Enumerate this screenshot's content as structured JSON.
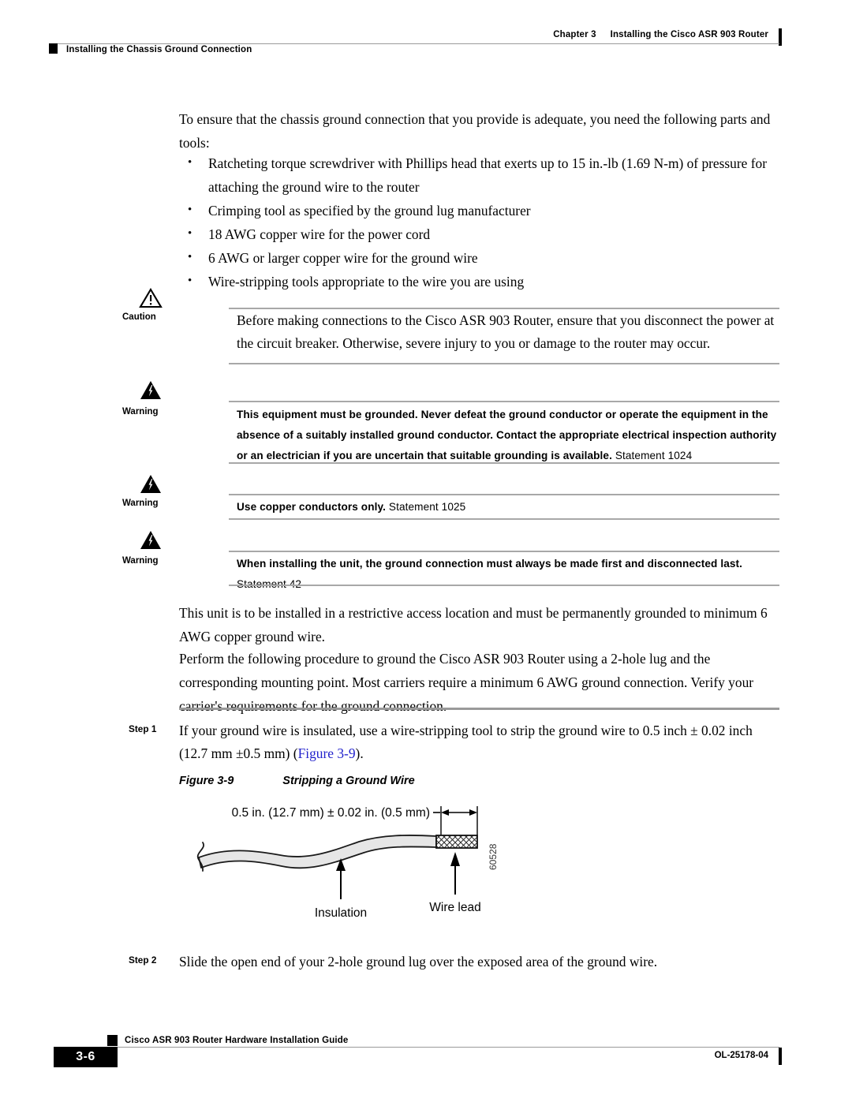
{
  "header": {
    "chapter_num": "Chapter 3",
    "chapter_title": "Installing the Cisco ASR 903 Router",
    "section_title": "Installing the Chassis Ground Connection"
  },
  "intro": {
    "paragraph": "To ensure that the chassis ground connection that you provide is adequate, you need the following parts and tools:"
  },
  "bullets": [
    "Ratcheting torque screwdriver with Phillips head that exerts up to 15 in.-lb (1.69 N-m) of pressure for attaching the ground wire to the router",
    "Crimping tool as specified by the ground lug manufacturer",
    "18 AWG copper wire for the power cord",
    "6 AWG or larger copper wire for the ground wire",
    "Wire-stripping tools appropriate to the wire you are using"
  ],
  "caution": {
    "label": "Caution",
    "icon": "caution-triangle-icon",
    "text": "Before making connections to the Cisco ASR 903 Router, ensure that you disconnect the power at the circuit breaker. Otherwise, severe injury to you or damage to the router may occur."
  },
  "warnings": [
    {
      "label": "Warning",
      "icon": "warning-lightning-icon",
      "text": "This equipment must be grounded. Never defeat the ground conductor or operate the equipment in the absence of a suitably installed ground conductor. Contact the appropriate electrical inspection authority or an electrician if you are uncertain that suitable grounding is available.",
      "statement": "Statement 1024"
    },
    {
      "label": "Warning",
      "icon": "warning-lightning-icon",
      "text": "Use copper conductors only.",
      "statement": "Statement 1025"
    },
    {
      "label": "Warning",
      "icon": "warning-lightning-icon",
      "text": "When installing the unit, the ground connection must always be made first and disconnected last.",
      "statement": "Statement 42"
    }
  ],
  "paragraphs": {
    "restrictive_access": "This unit is to be installed in a restrictive access location and must be permanently grounded to minimum 6 AWG copper ground wire.",
    "procedure_intro": "Perform the following procedure to ground the Cisco ASR 903 Router using a 2-hole lug and the corresponding mounting point. Most carriers require a minimum 6 AWG ground connection. Verify your carrier's requirements for the ground connection."
  },
  "steps": [
    {
      "label": "Step 1",
      "text_before": "If your ground wire is insulated, use a wire-stripping tool to strip the ground wire to 0.5 inch ± 0.02 inch (12.7 mm ±0.5 mm) (",
      "xref": "Figure 3-9",
      "text_after": ")."
    },
    {
      "label": "Step 2",
      "text_before": "Slide the open end of your 2-hole ground lug over the exposed area of the ground wire.",
      "xref": "",
      "text_after": ""
    }
  ],
  "figure": {
    "number": "Figure 3-9",
    "title": "Stripping a Ground Wire",
    "dimension_label": "0.5 in. (12.7 mm) ± 0.02 in. (0.5 mm)",
    "callout_insulation": "Insulation",
    "callout_wire_lead": "Wire lead",
    "serial": "60528"
  },
  "footer": {
    "guide_title": "Cisco ASR 903 Router Hardware Installation Guide",
    "page_number": "3-6",
    "doc_number": "OL-25178-04"
  }
}
